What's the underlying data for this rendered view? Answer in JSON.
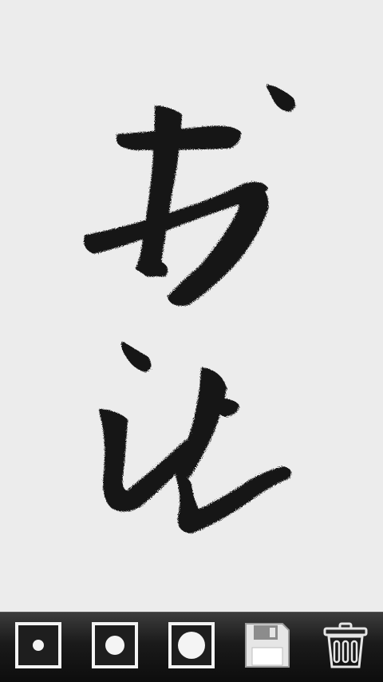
{
  "canvas": {
    "background": "#ececec",
    "ink_color": "#141414",
    "strokes_content": "handwritten-calligraphy"
  },
  "toolbar": {
    "background": "#1a1a1a",
    "tools": [
      {
        "name": "brush-small-button",
        "icon": "small-dot-icon"
      },
      {
        "name": "brush-medium-button",
        "icon": "medium-dot-icon"
      },
      {
        "name": "brush-large-button",
        "icon": "large-dot-icon"
      },
      {
        "name": "save-button",
        "icon": "floppy-disk-icon"
      },
      {
        "name": "clear-button",
        "icon": "trash-can-icon"
      }
    ]
  }
}
